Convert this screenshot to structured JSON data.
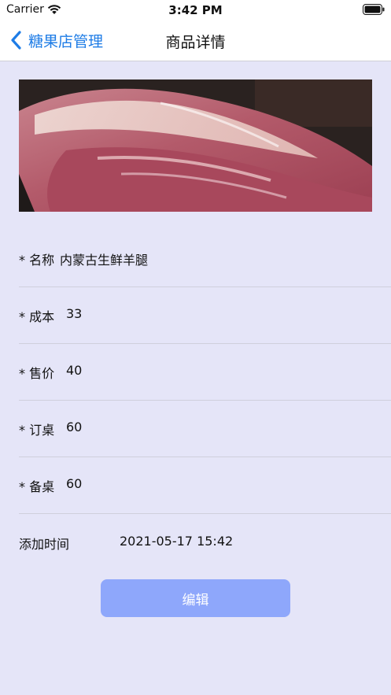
{
  "status_bar": {
    "carrier": "Carrier",
    "time": "3:42 PM"
  },
  "nav": {
    "back_label": "糖果店管理",
    "title": "商品详情",
    "accent_color": "#1e7ce6"
  },
  "product": {
    "fields": [
      {
        "label": "* 名称",
        "value": "内蒙古生鲜羊腿"
      },
      {
        "label": "* 成本",
        "value": "33"
      },
      {
        "label": "* 售价",
        "value": "40"
      },
      {
        "label": "* 订桌",
        "value": "60"
      },
      {
        "label": "* 备桌",
        "value": "60"
      }
    ],
    "added_time_label": "添加时间",
    "added_time_value": "2021-05-17 15:42"
  },
  "actions": {
    "edit_label": "编辑",
    "edit_color": "#8ea7fb"
  }
}
